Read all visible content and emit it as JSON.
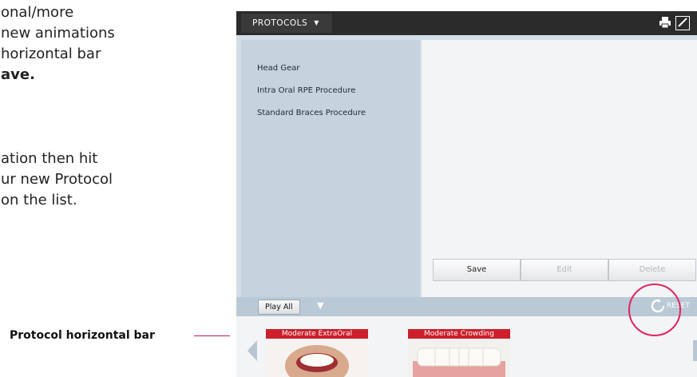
{
  "instructions": {
    "para1_line1": "onal/more",
    "para1_line2": "new animations",
    "para1_line3": "horizontal bar",
    "para1_line4": "ave.",
    "para2_line1": "ation then hit",
    "para2_line2": "ur new Protocol",
    "para2_line3": " on the list."
  },
  "callout": {
    "label": "Protocol horizontal bar"
  },
  "app": {
    "header": {
      "menu_label": "PROTOCOLS",
      "menu_caret": "▼",
      "print_icon": "print-icon",
      "draw_icon": "draw-icon"
    },
    "protocols": [
      "Head Gear",
      "Intra Oral RPE Procedure",
      "Standard Braces Procedure"
    ],
    "buttons": {
      "save": "Save",
      "edit": "Edit",
      "delete": "Delete"
    },
    "playbar": {
      "play_all": "Play All",
      "caret": "▼",
      "reset": "RESET"
    },
    "thumbnails": [
      "Moderate ExtraOral",
      "Moderate Crowding"
    ]
  },
  "colors": {
    "accent_red": "#cc1f2b",
    "highlight_pink": "#e0245e",
    "header_dark": "#2b2b2b",
    "panel_blue": "#c6d3df"
  }
}
